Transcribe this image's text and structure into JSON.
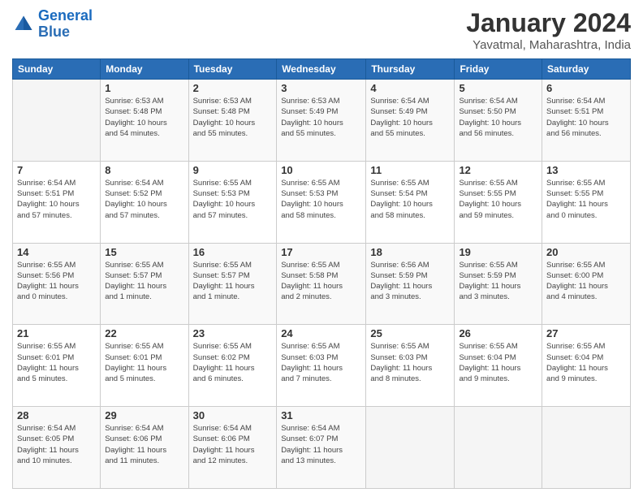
{
  "header": {
    "logo_text_general": "General",
    "logo_text_blue": "Blue",
    "month_year": "January 2024",
    "location": "Yavatmal, Maharashtra, India"
  },
  "days_of_week": [
    "Sunday",
    "Monday",
    "Tuesday",
    "Wednesday",
    "Thursday",
    "Friday",
    "Saturday"
  ],
  "weeks": [
    [
      {
        "day": "",
        "info": ""
      },
      {
        "day": "1",
        "info": "Sunrise: 6:53 AM\nSunset: 5:48 PM\nDaylight: 10 hours\nand 54 minutes."
      },
      {
        "day": "2",
        "info": "Sunrise: 6:53 AM\nSunset: 5:48 PM\nDaylight: 10 hours\nand 55 minutes."
      },
      {
        "day": "3",
        "info": "Sunrise: 6:53 AM\nSunset: 5:49 PM\nDaylight: 10 hours\nand 55 minutes."
      },
      {
        "day": "4",
        "info": "Sunrise: 6:54 AM\nSunset: 5:49 PM\nDaylight: 10 hours\nand 55 minutes."
      },
      {
        "day": "5",
        "info": "Sunrise: 6:54 AM\nSunset: 5:50 PM\nDaylight: 10 hours\nand 56 minutes."
      },
      {
        "day": "6",
        "info": "Sunrise: 6:54 AM\nSunset: 5:51 PM\nDaylight: 10 hours\nand 56 minutes."
      }
    ],
    [
      {
        "day": "7",
        "info": "Sunrise: 6:54 AM\nSunset: 5:51 PM\nDaylight: 10 hours\nand 57 minutes."
      },
      {
        "day": "8",
        "info": "Sunrise: 6:54 AM\nSunset: 5:52 PM\nDaylight: 10 hours\nand 57 minutes."
      },
      {
        "day": "9",
        "info": "Sunrise: 6:55 AM\nSunset: 5:53 PM\nDaylight: 10 hours\nand 57 minutes."
      },
      {
        "day": "10",
        "info": "Sunrise: 6:55 AM\nSunset: 5:53 PM\nDaylight: 10 hours\nand 58 minutes."
      },
      {
        "day": "11",
        "info": "Sunrise: 6:55 AM\nSunset: 5:54 PM\nDaylight: 10 hours\nand 58 minutes."
      },
      {
        "day": "12",
        "info": "Sunrise: 6:55 AM\nSunset: 5:55 PM\nDaylight: 10 hours\nand 59 minutes."
      },
      {
        "day": "13",
        "info": "Sunrise: 6:55 AM\nSunset: 5:55 PM\nDaylight: 11 hours\nand 0 minutes."
      }
    ],
    [
      {
        "day": "14",
        "info": "Sunrise: 6:55 AM\nSunset: 5:56 PM\nDaylight: 11 hours\nand 0 minutes."
      },
      {
        "day": "15",
        "info": "Sunrise: 6:55 AM\nSunset: 5:57 PM\nDaylight: 11 hours\nand 1 minute."
      },
      {
        "day": "16",
        "info": "Sunrise: 6:55 AM\nSunset: 5:57 PM\nDaylight: 11 hours\nand 1 minute."
      },
      {
        "day": "17",
        "info": "Sunrise: 6:55 AM\nSunset: 5:58 PM\nDaylight: 11 hours\nand 2 minutes."
      },
      {
        "day": "18",
        "info": "Sunrise: 6:56 AM\nSunset: 5:59 PM\nDaylight: 11 hours\nand 3 minutes."
      },
      {
        "day": "19",
        "info": "Sunrise: 6:55 AM\nSunset: 5:59 PM\nDaylight: 11 hours\nand 3 minutes."
      },
      {
        "day": "20",
        "info": "Sunrise: 6:55 AM\nSunset: 6:00 PM\nDaylight: 11 hours\nand 4 minutes."
      }
    ],
    [
      {
        "day": "21",
        "info": "Sunrise: 6:55 AM\nSunset: 6:01 PM\nDaylight: 11 hours\nand 5 minutes."
      },
      {
        "day": "22",
        "info": "Sunrise: 6:55 AM\nSunset: 6:01 PM\nDaylight: 11 hours\nand 5 minutes."
      },
      {
        "day": "23",
        "info": "Sunrise: 6:55 AM\nSunset: 6:02 PM\nDaylight: 11 hours\nand 6 minutes."
      },
      {
        "day": "24",
        "info": "Sunrise: 6:55 AM\nSunset: 6:03 PM\nDaylight: 11 hours\nand 7 minutes."
      },
      {
        "day": "25",
        "info": "Sunrise: 6:55 AM\nSunset: 6:03 PM\nDaylight: 11 hours\nand 8 minutes."
      },
      {
        "day": "26",
        "info": "Sunrise: 6:55 AM\nSunset: 6:04 PM\nDaylight: 11 hours\nand 9 minutes."
      },
      {
        "day": "27",
        "info": "Sunrise: 6:55 AM\nSunset: 6:04 PM\nDaylight: 11 hours\nand 9 minutes."
      }
    ],
    [
      {
        "day": "28",
        "info": "Sunrise: 6:54 AM\nSunset: 6:05 PM\nDaylight: 11 hours\nand 10 minutes."
      },
      {
        "day": "29",
        "info": "Sunrise: 6:54 AM\nSunset: 6:06 PM\nDaylight: 11 hours\nand 11 minutes."
      },
      {
        "day": "30",
        "info": "Sunrise: 6:54 AM\nSunset: 6:06 PM\nDaylight: 11 hours\nand 12 minutes."
      },
      {
        "day": "31",
        "info": "Sunrise: 6:54 AM\nSunset: 6:07 PM\nDaylight: 11 hours\nand 13 minutes."
      },
      {
        "day": "",
        "info": ""
      },
      {
        "day": "",
        "info": ""
      },
      {
        "day": "",
        "info": ""
      }
    ]
  ]
}
